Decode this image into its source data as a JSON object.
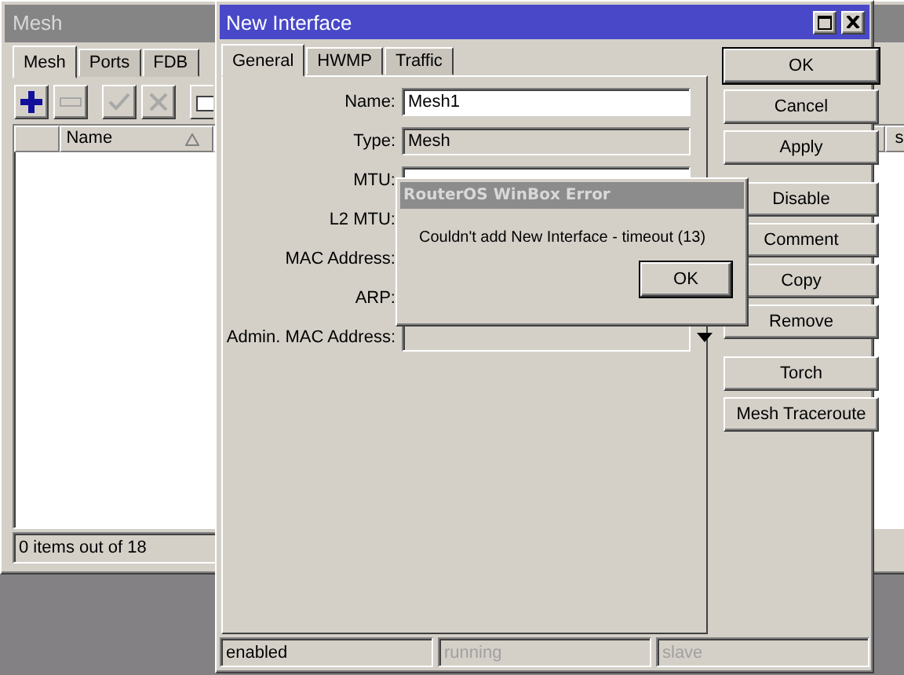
{
  "mesh_window": {
    "title": "Mesh",
    "tabs": [
      {
        "label": "Mesh",
        "selected": true
      },
      {
        "label": "Ports",
        "selected": false
      },
      {
        "label": "FDB",
        "selected": false
      }
    ],
    "toolbar": [
      {
        "kind": "add",
        "disabled": false
      },
      {
        "kind": "remove",
        "disabled": true
      },
      {
        "kind": "enable",
        "disabled": true
      },
      {
        "kind": "disable",
        "disabled": true
      },
      {
        "kind": "comment",
        "disabled": false
      }
    ],
    "table": {
      "columns": [
        {
          "label": "Name"
        },
        {
          "label": "s"
        }
      ]
    },
    "status_bar": "0 items out of 18"
  },
  "interface_window": {
    "title": "New Interface",
    "tabs": [
      {
        "label": "General",
        "selected": true
      },
      {
        "label": "HWMP",
        "selected": false
      },
      {
        "label": "Traffic",
        "selected": false
      }
    ],
    "fields": [
      {
        "label": "Name:",
        "kind": "text",
        "value": "Mesh1",
        "disabled": false
      },
      {
        "label": "Type:",
        "kind": "text",
        "value": "Mesh",
        "disabled": true
      },
      {
        "label": "MTU:",
        "kind": "text",
        "disabled": false
      },
      {
        "label": "L2 MTU:",
        "kind": "hidden"
      },
      {
        "label": "MAC Address:",
        "kind": "hidden"
      },
      {
        "label": "ARP:",
        "kind": "hidden"
      },
      {
        "label": "Admin. MAC Address:",
        "kind": "dropdown",
        "disabled": true
      }
    ],
    "buttons": [
      {
        "label": "OK",
        "default": true
      },
      {
        "label": "Cancel",
        "default": false
      },
      {
        "label": "Apply",
        "default": false
      },
      {
        "label": "Disable",
        "default": false
      },
      {
        "label": "Comment",
        "default": false
      },
      {
        "label": "Copy",
        "default": false
      },
      {
        "label": "Remove",
        "default": false
      },
      {
        "label": "Torch",
        "default": false
      },
      {
        "label": "Mesh Traceroute",
        "default": false
      }
    ],
    "status_bar": [
      {
        "label": "enabled",
        "active": true
      },
      {
        "label": "running",
        "active": false
      },
      {
        "label": "slave",
        "active": false
      }
    ]
  },
  "error_dialog": {
    "title": "RouterOS WinBox Error",
    "message": "Couldn't add New Interface - timeout (13)",
    "button": "OK"
  }
}
